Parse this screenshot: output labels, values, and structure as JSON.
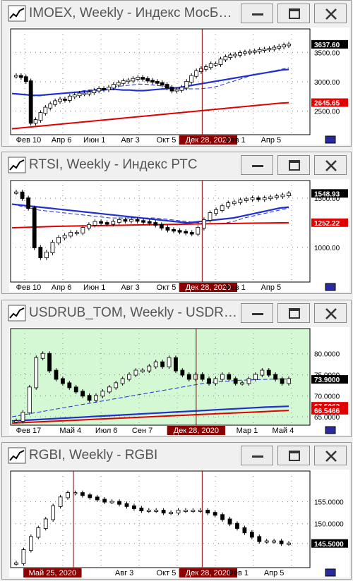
{
  "windows": [
    {
      "title": "IMOEX, Weekly - Индекс МосБиржи",
      "bg": "#ffffff",
      "price_min": 2100,
      "price_max": 3900,
      "price_ticks": [
        "3500.00",
        "3000.00",
        "2500.00"
      ],
      "price_tick_values": [
        3500,
        3000,
        2500
      ],
      "badges": [
        {
          "label": "3637.60",
          "value": 3637.6,
          "color": "#000000"
        },
        {
          "label": "2645.65",
          "value": 2645.65,
          "color": "#e00000"
        }
      ],
      "date_labels": [
        "Фев 10",
        "Апр 6",
        "Июн 1",
        "Авг 3",
        "Окт 5",
        "Дек 28, 2020",
        "Фев 1",
        "Апр 5"
      ],
      "marker_labels": [
        "Дек 28, 2020"
      ],
      "candles": [
        3100,
        3080,
        3010,
        2300,
        2350,
        2470,
        2560,
        2620,
        2670,
        2700,
        2690,
        2750,
        2770,
        2800,
        2800,
        2820,
        2850,
        2880,
        2870,
        2900,
        2950,
        2980,
        3010,
        3020,
        3050,
        3070,
        3050,
        3020,
        3000,
        2980,
        2950,
        2900,
        2850,
        2860,
        2900,
        3000,
        3100,
        3180,
        3220,
        3250,
        3300,
        3300,
        3380,
        3420,
        3450,
        3460,
        3490,
        3500,
        3510,
        3520,
        3540,
        3550,
        3560,
        3580,
        3600,
        3620,
        3637
      ],
      "ma_fast": [
        2800,
        2790,
        2780,
        2770,
        2760,
        2760,
        2770,
        2780,
        2790,
        2800,
        2810,
        2820,
        2830,
        2850,
        2860,
        2870,
        2880,
        2890,
        2900,
        2920,
        2930,
        2940,
        2950,
        2960,
        2960,
        2950,
        2940,
        2930,
        2920,
        2910,
        2890,
        2880,
        2880,
        2880,
        2880,
        2890,
        2900,
        2920,
        2950,
        2980,
        3010,
        3040,
        3070,
        3100,
        3120,
        3140,
        3160,
        3180,
        3200,
        3220,
        3240
      ],
      "ma_slow": [
        2800,
        2790,
        2780,
        2770,
        2770,
        2780,
        2790,
        2800,
        2810,
        2820,
        2830,
        2840,
        2850,
        2860,
        2870,
        2870,
        2860,
        2860,
        2850,
        2850,
        2860,
        2870,
        2880,
        2890,
        2900,
        2920,
        2940,
        2960,
        2980,
        3000,
        3020,
        3040,
        3060,
        3080,
        3100,
        3120,
        3140,
        3160,
        3180,
        3200,
        3210
      ],
      "ma_red": [
        2200,
        2215,
        2230,
        2245,
        2260,
        2275,
        2290,
        2305,
        2320,
        2335,
        2350,
        2365,
        2380,
        2395,
        2410,
        2425,
        2440,
        2455,
        2470,
        2485,
        2500,
        2515,
        2530,
        2545,
        2560,
        2575,
        2590,
        2605,
        2620,
        2635,
        2645
      ]
    },
    {
      "title": "RTSI, Weekly - Индекс РТС",
      "bg": "#ffffff",
      "price_min": 650,
      "price_max": 1680,
      "price_ticks": [
        "1500.00",
        "1000.00"
      ],
      "price_tick_values": [
        1500,
        1000
      ],
      "badges": [
        {
          "label": "1548.93",
          "value": 1548.93,
          "color": "#000000"
        },
        {
          "label": "1252.22",
          "value": 1252.22,
          "color": "#e00000"
        }
      ],
      "date_labels": [
        "Фев 10",
        "Апр 6",
        "Июн 1",
        "Авг 3",
        "Окт 5",
        "Дек 28, 2020",
        "Фев 1",
        "Апр 5"
      ],
      "marker_labels": [
        "Дек 28, 2020"
      ],
      "candles": [
        1560,
        1500,
        1400,
        1000,
        900,
        950,
        1050,
        1100,
        1120,
        1150,
        1150,
        1200,
        1230,
        1260,
        1250,
        1240,
        1260,
        1280,
        1270,
        1280,
        1270,
        1260,
        1250,
        1230,
        1200,
        1180,
        1170,
        1160,
        1150,
        1140,
        1200,
        1280,
        1350,
        1380,
        1420,
        1450,
        1460,
        1480,
        1490,
        1500,
        1490,
        1500,
        1510,
        1520,
        1530,
        1548
      ],
      "ma_fast": [
        1440,
        1420,
        1400,
        1380,
        1370,
        1360,
        1350,
        1340,
        1330,
        1320,
        1310,
        1300,
        1300,
        1300,
        1300,
        1300,
        1300,
        1290,
        1280,
        1270,
        1260,
        1250,
        1240,
        1240,
        1250,
        1270,
        1300,
        1320,
        1340,
        1360,
        1380,
        1400
      ],
      "ma_slow": [
        1440,
        1430,
        1420,
        1410,
        1400,
        1390,
        1380,
        1370,
        1360,
        1350,
        1340,
        1330,
        1320,
        1310,
        1300,
        1290,
        1280,
        1270,
        1260,
        1250,
        1260,
        1270,
        1280,
        1290,
        1300,
        1320,
        1340,
        1360,
        1380,
        1400,
        1410
      ],
      "ma_red": [
        1200,
        1205,
        1210,
        1215,
        1218,
        1220,
        1222,
        1225,
        1228,
        1230,
        1232,
        1235,
        1237,
        1240,
        1242,
        1244,
        1246,
        1248,
        1250,
        1252
      ]
    },
    {
      "title": "USDRUB_TOM, Weekly - USDRUB_TOM",
      "bg": "#d4f7d4",
      "price_min": 63,
      "price_max": 86,
      "price_ticks": [
        "80.0000",
        "75.0000",
        "70.0000",
        "65.0000"
      ],
      "price_tick_values": [
        80,
        75,
        70,
        65
      ],
      "badges": [
        {
          "label": "73.9000",
          "value": 73.9,
          "color": "#000000"
        },
        {
          "label": "67.5062",
          "value": 67.5062,
          "color": "#e00000"
        },
        {
          "label": "66.5466",
          "value": 66.5466,
          "color": "#e00000"
        }
      ],
      "date_labels": [
        "Фев 17",
        "Май 4",
        "Июл 6",
        "Сен 7",
        "Дек 28, 2020",
        "Мар 1",
        "Май 4"
      ],
      "marker_labels": [
        "Дек 28, 2020"
      ],
      "candles": [
        64,
        66,
        72,
        79,
        80,
        76,
        74,
        73,
        72,
        71,
        70,
        69,
        70,
        71,
        72,
        73,
        74,
        75,
        76,
        76,
        77,
        78,
        77,
        79,
        76,
        75,
        74,
        75,
        74,
        73,
        74,
        75,
        74,
        73,
        73,
        74,
        75,
        76,
        75,
        74,
        73,
        74
      ],
      "ma_fast": [
        65,
        65.5,
        66,
        66.5,
        67,
        67.5,
        68,
        68.5,
        69,
        69.5,
        70,
        70.5,
        71,
        71.5,
        72,
        72.5,
        73,
        73.3,
        73.5,
        73.7,
        73.8,
        73.9,
        74,
        74
      ],
      "ma_slow": [
        64,
        64.3,
        64.6,
        64.9,
        65.2,
        65.5,
        65.8,
        66.1,
        66.4,
        66.7,
        67,
        67.3,
        67.5
      ],
      "ma_red": [
        63.5,
        63.8,
        64.1,
        64.4,
        64.7,
        65,
        65.3,
        65.6,
        65.9,
        66.2,
        66.5
      ]
    },
    {
      "title": "RGBI, Weekly - RGBI",
      "bg": "#ffffff",
      "price_min": 140,
      "price_max": 162,
      "price_ticks": [
        "155.0000",
        "150.0000",
        "145.5000"
      ],
      "price_tick_values": [
        155,
        150,
        145.5
      ],
      "badges": [
        {
          "label": "145.5000",
          "value": 145.5,
          "color": "#000000"
        }
      ],
      "date_labels": [
        "Май 25, 2020",
        "Авг 3",
        "Окт 5",
        "Дек 28, 2020",
        "Фев 1",
        "Апр 5"
      ],
      "marker_labels": [
        "Май 25, 2020",
        "Дек 28, 2020"
      ],
      "candles": [
        141,
        144,
        147,
        149,
        151,
        154,
        156,
        157,
        157,
        156.5,
        156,
        155.5,
        155,
        155,
        154.5,
        154,
        153.5,
        153,
        153,
        153,
        152.5,
        152.5,
        153,
        153,
        153,
        153,
        152.5,
        152,
        151,
        150,
        149,
        148,
        147,
        146,
        146,
        146,
        145.5,
        145.5
      ],
      "ma_fast": [],
      "ma_slow": [],
      "ma_red": []
    }
  ]
}
